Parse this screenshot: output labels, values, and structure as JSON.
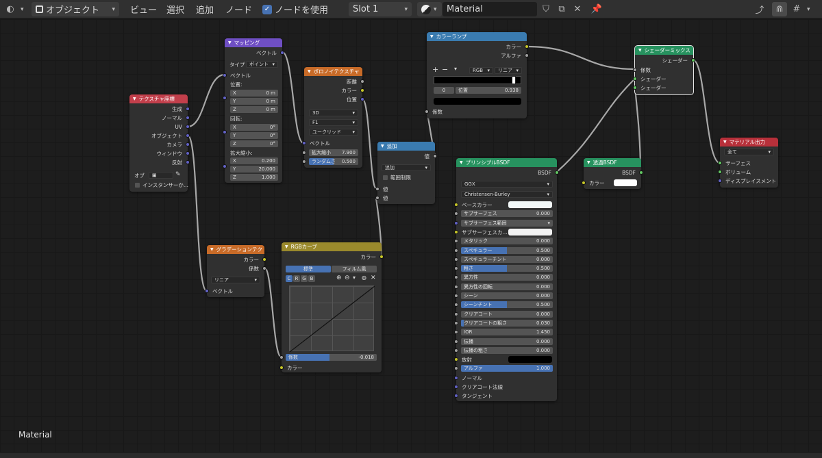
{
  "toolbar": {
    "editor_icon": "node-editor-icon",
    "object_mode": "オブジェクト",
    "menus": [
      "ビュー",
      "選択",
      "追加",
      "ノード"
    ],
    "use_nodes_label": "ノードを使用",
    "use_nodes_checked": true,
    "slot": "Slot 1",
    "material_name": "Material"
  },
  "status": {
    "material_label": "Material"
  },
  "nodes": {
    "texcoord": {
      "title": "テクスチャ座標",
      "outputs": [
        "生成",
        "ノーマル",
        "UV",
        "オブジェクト",
        "カメラ",
        "ウィンドウ",
        "反射"
      ],
      "object_label": "オブ",
      "instancer": "インスタンサーか..."
    },
    "mapping": {
      "title": "マッピング",
      "out": "ベクトル",
      "type_label": "タイプ",
      "type_value": "ポイント",
      "vector": "ベクトル",
      "location": "位置:",
      "rotation": "回転:",
      "scale": "拡大縮小:",
      "loc": [
        {
          "axis": "X",
          "value": "0 m"
        },
        {
          "axis": "Y",
          "value": "0 m"
        },
        {
          "axis": "Z",
          "value": "0 m"
        }
      ],
      "rot": [
        {
          "axis": "X",
          "value": "0°"
        },
        {
          "axis": "Y",
          "value": "0°"
        },
        {
          "axis": "Z",
          "value": "0°"
        }
      ],
      "scl": [
        {
          "axis": "X",
          "value": "0.200"
        },
        {
          "axis": "Y",
          "value": "20.000"
        },
        {
          "axis": "Z",
          "value": "1.000"
        }
      ]
    },
    "voronoi": {
      "title": "ボロノイテクスチャ",
      "outputs": [
        "距離",
        "カラー",
        "位置"
      ],
      "dims": "3D",
      "feature": "F1",
      "metric": "ユークリッド",
      "vector": "ベクトル",
      "scale_label": "拡大縮小",
      "scale_value": "7.900",
      "random_label": "ランダムさ",
      "random_value": "0.500",
      "random_fill": 0.5
    },
    "add": {
      "title": "追加",
      "out": "値",
      "op": "追加",
      "clamp": "範囲制限",
      "in1": "値",
      "in2": "値"
    },
    "gradient": {
      "title": "グラデーションテク",
      "outputs": [
        "カラー",
        "係数"
      ],
      "type": "リニア",
      "vector": "ベクトル"
    },
    "rgbcurve": {
      "title": "RGBカーブ",
      "out": "カラー",
      "tab_standard": "標準",
      "tab_film": "フィルム風",
      "channels": [
        "C",
        "R",
        "G",
        "B"
      ],
      "fac_label": "係数",
      "fac_value": "-0.018",
      "color_in": "カラー"
    },
    "colorramp": {
      "title": "カラーランプ",
      "outputs": [
        "カラー",
        "アルファ"
      ],
      "mode": "RGB",
      "interp": "リニア",
      "pos_index": "0",
      "pos_label": "位置",
      "pos_value": "0.938",
      "fac": "係数"
    },
    "bsdf": {
      "title": "プリンシプルBSDF",
      "out": "BSDF",
      "dist": "GGX",
      "sss_method": "Christensen-Burley",
      "rows": [
        {
          "label": "ベースカラー",
          "kind": "color",
          "color": "#f2f8f8"
        },
        {
          "label": "サブサーフェス",
          "kind": "num",
          "value": "0.000",
          "fill": 0
        },
        {
          "label": "サブサーフェス範囲",
          "kind": "drop",
          "value": ""
        },
        {
          "label": "サブサーフェスカ...",
          "kind": "color",
          "color": "#f2f2f2"
        },
        {
          "label": "メタリック",
          "kind": "num",
          "value": "0.000",
          "fill": 0
        },
        {
          "label": "スペキュラー",
          "kind": "num",
          "value": "0.500",
          "fill": 0.5
        },
        {
          "label": "スペキュラーチント",
          "kind": "num",
          "value": "0.000",
          "fill": 0
        },
        {
          "label": "粗さ",
          "kind": "num",
          "value": "0.500",
          "fill": 0.5
        },
        {
          "label": "異方性",
          "kind": "num",
          "value": "0.000",
          "fill": 0
        },
        {
          "label": "異方性の回転",
          "kind": "num",
          "value": "0.000",
          "fill": 0
        },
        {
          "label": "シーン",
          "kind": "num",
          "value": "0.000",
          "fill": 0
        },
        {
          "label": "シーンチント",
          "kind": "num",
          "value": "0.500",
          "fill": 0.5
        },
        {
          "label": "クリアコート",
          "kind": "num",
          "value": "0.000",
          "fill": 0
        },
        {
          "label": "クリアコートの粗さ",
          "kind": "num",
          "value": "0.030",
          "fill": 0.03
        },
        {
          "label": "IOR",
          "kind": "num",
          "value": "1.450",
          "fill": 0
        },
        {
          "label": "伝播",
          "kind": "num",
          "value": "0.000",
          "fill": 0
        },
        {
          "label": "伝播の粗さ",
          "kind": "num",
          "value": "0.000",
          "fill": 0
        },
        {
          "label": "放射",
          "kind": "color",
          "color": "#000000"
        },
        {
          "label": "アルファ",
          "kind": "num",
          "value": "1.000",
          "fill": 1
        },
        {
          "label": "ノーマル",
          "kind": "vec"
        },
        {
          "label": "クリアコート法線",
          "kind": "vec"
        },
        {
          "label": "タンジェント",
          "kind": "vec"
        }
      ]
    },
    "transparent": {
      "title": "透過BSDF",
      "out": "BSDF",
      "color": "カラー"
    },
    "mix": {
      "title": "シェーダーミックス",
      "out": "シェーダー",
      "fac": "係数",
      "in1": "シェーダー",
      "in2": "シェーダー"
    },
    "output": {
      "title": "マテリアル出力",
      "target": "全て",
      "surface": "サーフェス",
      "volume": "ボリューム",
      "displacement": "ディスプレイスメント"
    }
  }
}
